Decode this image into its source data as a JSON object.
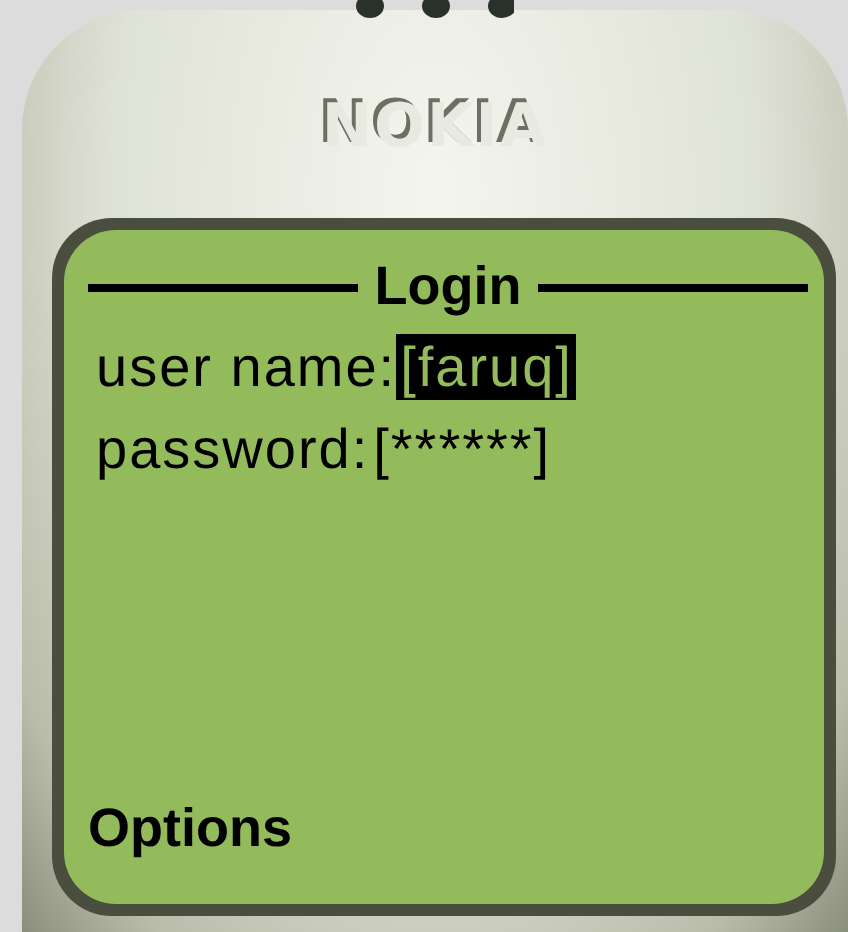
{
  "brand": "NOKIA",
  "screen": {
    "title": "Login",
    "fields": [
      {
        "label": "user name:",
        "value": "[faruq]",
        "selected": true
      },
      {
        "label": "password:",
        "value": "[******]",
        "selected": false
      }
    ],
    "softkey": "Options"
  }
}
